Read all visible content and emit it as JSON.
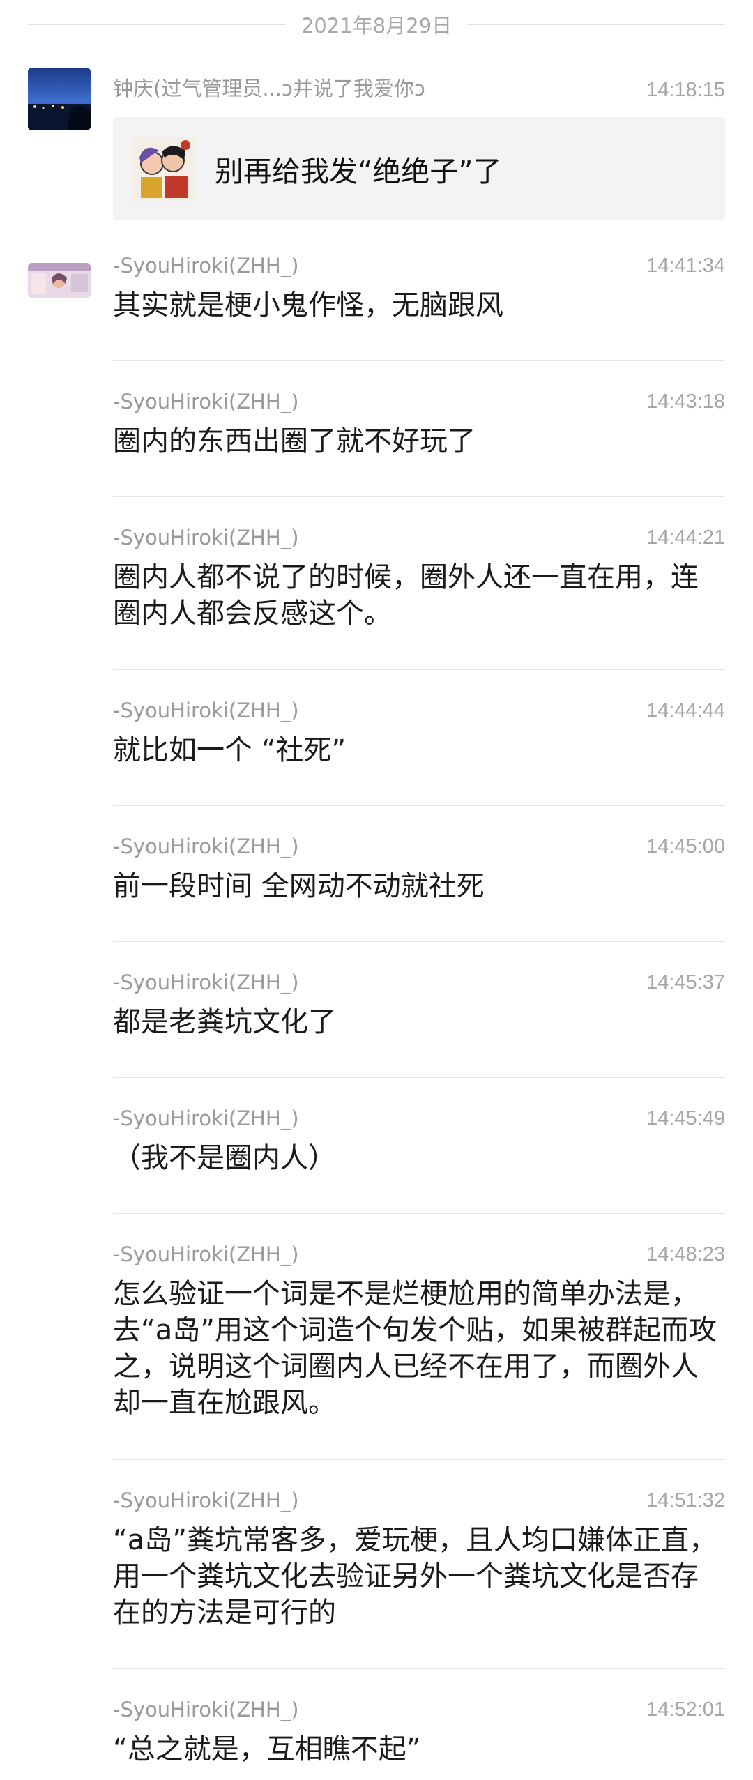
{
  "date_label": "2021年8月29日",
  "messages": [
    {
      "name": "钟庆(过气管理员...ɔ并说了我爱你ɔ",
      "time": "14:18:15",
      "quote_text": "别再给我发“绝绝子”了",
      "avatar": "night-city-avatar"
    },
    {
      "name": "-SyouHiroki(ZHH_)",
      "time": "14:41:34",
      "text": "其实就是梗小鬼作怪，无脑跟风",
      "avatar": "anime-banner-avatar"
    },
    {
      "name": "-SyouHiroki(ZHH_)",
      "time": "14:43:18",
      "text": "圈内的东西出圈了就不好玩了"
    },
    {
      "name": "-SyouHiroki(ZHH_)",
      "time": "14:44:21",
      "text": "圈内人都不说了的时候，圈外人还一直在用，连圈内人都会反感这个。"
    },
    {
      "name": "-SyouHiroki(ZHH_)",
      "time": "14:44:44",
      "text": "就比如一个 “社死”"
    },
    {
      "name": "-SyouHiroki(ZHH_)",
      "time": "14:45:00",
      "text": "前一段时间 全网动不动就社死"
    },
    {
      "name": "-SyouHiroki(ZHH_)",
      "time": "14:45:37",
      "text": "都是老粪坑文化了"
    },
    {
      "name": "-SyouHiroki(ZHH_)",
      "time": "14:45:49",
      "text": "（我不是圈内人）"
    },
    {
      "name": "-SyouHiroki(ZHH_)",
      "time": "14:48:23",
      "text": "怎么验证一个词是不是烂梗尬用的简单办法是，去“a岛”用这个词造个句发个贴，如果被群起而攻之，说明这个词圈内人已经不在用了，而圈外人却一直在尬跟风。"
    },
    {
      "name": "-SyouHiroki(ZHH_)",
      "time": "14:51:32",
      "text": "“a岛”粪坑常客多，爱玩梗，且人均口嫌体正直，用一个粪坑文化去验证另外一个粪坑文化是否存在的方法是可行的"
    },
    {
      "name": "-SyouHiroki(ZHH_)",
      "time": "14:52:01",
      "text": "“总之就是，互相瞧不起”"
    }
  ]
}
